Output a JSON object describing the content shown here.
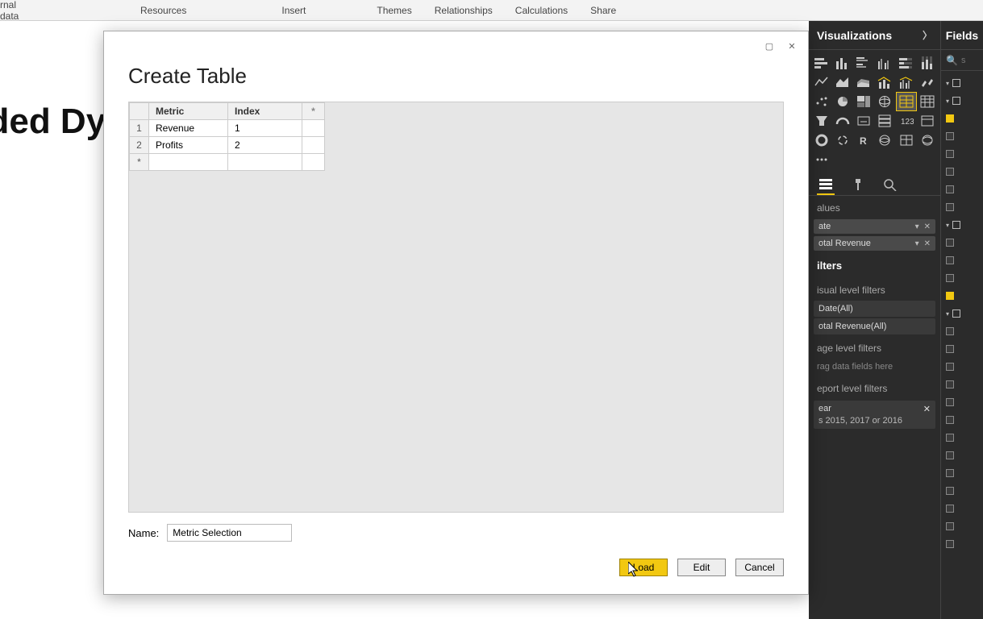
{
  "ribbon": {
    "tabs": [
      "rnal data",
      "Resources",
      "Insert",
      "Themes",
      "Relationships",
      "Calculations",
      "Share"
    ]
  },
  "canvas": {
    "big_text": "aded Dy"
  },
  "dialog": {
    "title": "Create Table",
    "columns": {
      "rownum": "",
      "metric": "Metric",
      "index": "Index",
      "star": "*"
    },
    "rows": [
      {
        "n": "1",
        "metric": "Revenue",
        "index": "1"
      },
      {
        "n": "2",
        "metric": "Profits",
        "index": "2"
      }
    ],
    "star_row": "*",
    "name_label": "Name:",
    "name_value": "Metric Selection",
    "buttons": {
      "load": "Load",
      "edit": "Edit",
      "cancel": "Cancel"
    },
    "window": {
      "max": "▢",
      "close": "✕"
    }
  },
  "viz": {
    "header": "Visualizations",
    "section_values": "alues",
    "pills": [
      {
        "label": "ate"
      },
      {
        "label": "otal Revenue"
      }
    ],
    "filters_header": "ilters",
    "visual_filters_label": "isual level filters",
    "visual_filters": [
      {
        "label": "Date(All)"
      },
      {
        "label": "otal Revenue(All)"
      }
    ],
    "page_filters_label": "age level filters",
    "drag_hint": "rag data fields here",
    "report_filters_label": "eport level filters",
    "year_filter": {
      "label": "ear",
      "detail": "s 2015, 2017 or 2016",
      "close": "✕"
    }
  },
  "fields": {
    "header": "Fields",
    "search_glyph": "🔍",
    "search_placeholder": "s"
  }
}
